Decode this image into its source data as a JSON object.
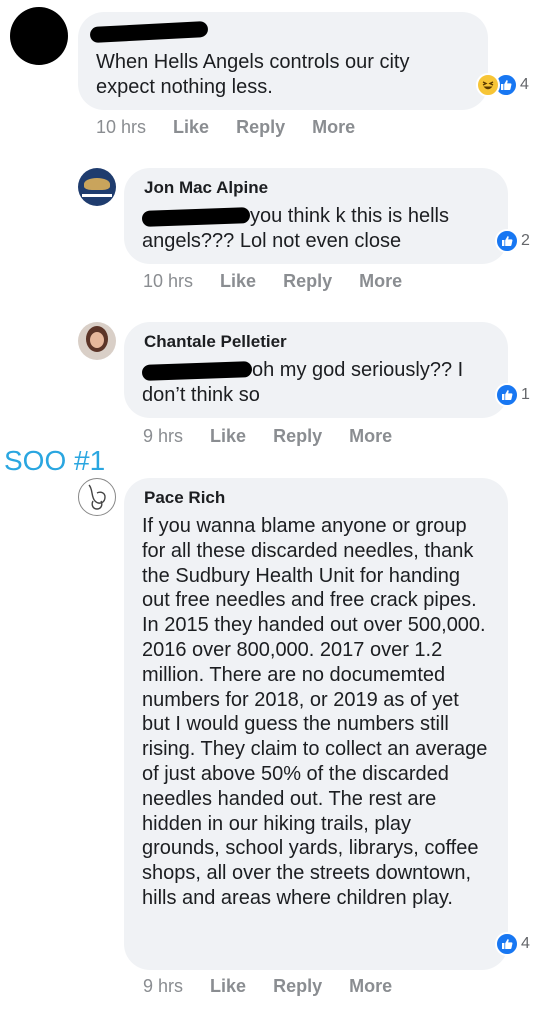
{
  "comments": [
    {
      "author": "",
      "text_lines": [
        "When Hells Angels controls our city",
        "expect nothing less."
      ],
      "time": "10 hrs",
      "reaction_count": "4"
    },
    {
      "author": "Jon Mac Alpine",
      "text_line1_suffix": "you think k this is hells",
      "text_line2": "angels??? Lol not even close",
      "time": "10 hrs",
      "reaction_count": "2"
    },
    {
      "author": "Chantale Pelletier",
      "text_line1_suffix": "oh my god seriously?? I",
      "text_line2": "don’t think so",
      "time": "9 hrs",
      "reaction_count": "1"
    },
    {
      "author": "Pace Rich",
      "text": "If you wanna blame anyone or group for all these discarded needles, thank the Sudbury Health Unit for handing out free needles and free crack pipes. In 2015 they handed out over 500,000. 2016 over 800,000. 2017 over 1.2 million. There are no documemted numbers for 2018, or 2019 as of yet but I would guess the numbers still rising. They claim to collect an average of just above 50% of the discarded needles handed out. The rest are hidden in our hiking trails, play grounds, school yards, librarys, coffee shops, all over the streets downtown, hills and areas where children play.",
      "time": "9 hrs",
      "reaction_count": "4"
    }
  ],
  "actions": {
    "like": "Like",
    "reply": "Reply",
    "more": "More"
  },
  "annotation": "SOO #1",
  "colors": {
    "bubble": "#f0f2f5",
    "like_blue": "#1877f2",
    "haha_yellow": "#f7c536",
    "annotation": "#2aa6e0",
    "meta_gray": "#8a8d91"
  },
  "icons": [
    "like-reaction-icon",
    "haha-reaction-icon"
  ]
}
